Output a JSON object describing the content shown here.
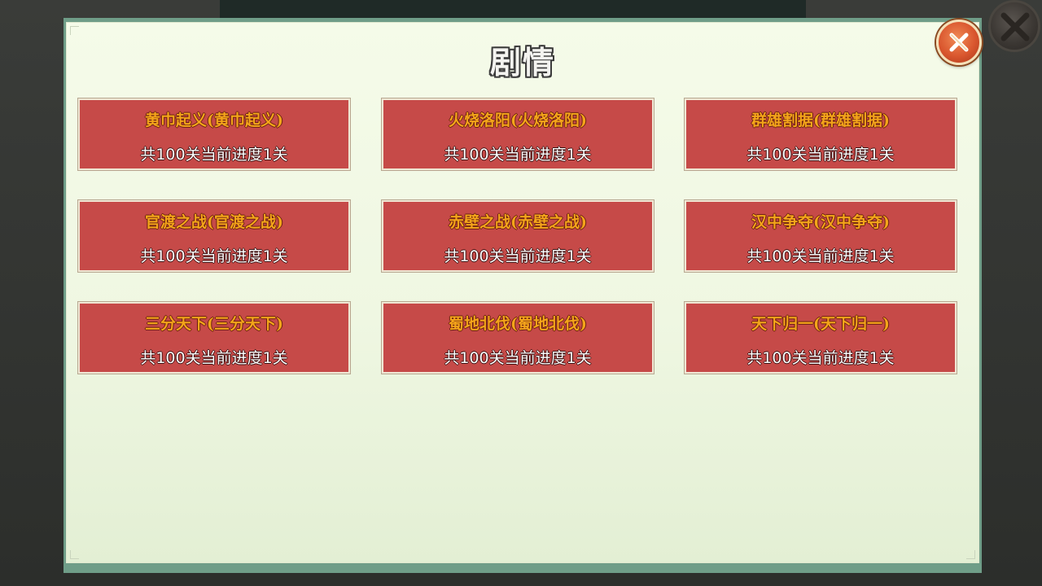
{
  "dialog": {
    "title": "剧情"
  },
  "chapters": [
    {
      "title": "黄巾起义(黄巾起义)",
      "progress": "共100关当前进度1关"
    },
    {
      "title": "火烧洛阳(火烧洛阳)",
      "progress": "共100关当前进度1关"
    },
    {
      "title": "群雄割据(群雄割据)",
      "progress": "共100关当前进度1关"
    },
    {
      "title": "官渡之战(官渡之战)",
      "progress": "共100关当前进度1关"
    },
    {
      "title": "赤壁之战(赤壁之战)",
      "progress": "共100关当前进度1关"
    },
    {
      "title": "汉中争夺(汉中争夺)",
      "progress": "共100关当前进度1关"
    },
    {
      "title": "三分天下(三分天下)",
      "progress": "共100关当前进度1关"
    },
    {
      "title": "蜀地北伐(蜀地北伐)",
      "progress": "共100关当前进度1关"
    },
    {
      "title": "天下归一(天下归一)",
      "progress": "共100关当前进度1关"
    }
  ],
  "icons": {
    "close": "close-icon",
    "background_close": "close-icon"
  },
  "colors": {
    "card_bg": "#c64a48",
    "card_title": "#f4a51a",
    "panel_bg": "#f5fbe9",
    "close_button": "#d9562e"
  }
}
